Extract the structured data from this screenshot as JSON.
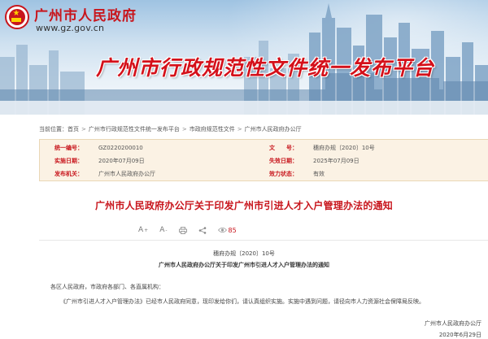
{
  "header": {
    "site_name": "广州市人民政府",
    "site_url": "www.gz.gov.cn",
    "platform_title": "广州市行政规范性文件统一发布平台"
  },
  "breadcrumb": {
    "location_label": "当前位置：",
    "items": [
      "首页",
      "广州市行政规范性文件统一发布平台",
      "市政府规范性文件",
      "广州市人民政府办公厅"
    ]
  },
  "info": {
    "rows": [
      {
        "k1": "统一编号：",
        "v1": "GZ0220200010",
        "k2": "文　　号：",
        "v2": "穗府办规〔2020〕10号"
      },
      {
        "k1": "实施日期：",
        "v1": "2020年07月09日",
        "k2": "失效日期：",
        "v2": "2025年07月09日"
      },
      {
        "k1": "发布机关：",
        "v1": "广州市人民政府办公厅",
        "k2": "效力状态：",
        "v2": "有效"
      }
    ]
  },
  "document": {
    "title": "广州市人民政府办公厅关于印发广州市引进人才入户管理办法的通知",
    "doc_number": "穗府办规〔2020〕10号",
    "subtitle": "广州市人民政府办公厅关于印发广州市引进人才入户管理办法的通知",
    "salutation": "各区人民政府，市政府各部门、各直属机构：",
    "body": "《广州市引进人才入户管理办法》已经市人民政府同意，现印发给你们，请认真组织实施。实施中遇到问题，请径向市人力资源社会保障局反映。",
    "signature": "广州市人民政府办公厅",
    "date": "2020年6月29日"
  },
  "toolbar": {
    "font_larger": "A",
    "font_larger_sup": "+",
    "font_smaller": "A",
    "font_smaller_sup": "-",
    "print_icon": "printer-icon",
    "share_icon": "share-icon",
    "views_icon": "eye-icon",
    "view_count": "85"
  },
  "colors": {
    "brand_red": "#c8161d",
    "info_bg": "#fbf2e4"
  }
}
